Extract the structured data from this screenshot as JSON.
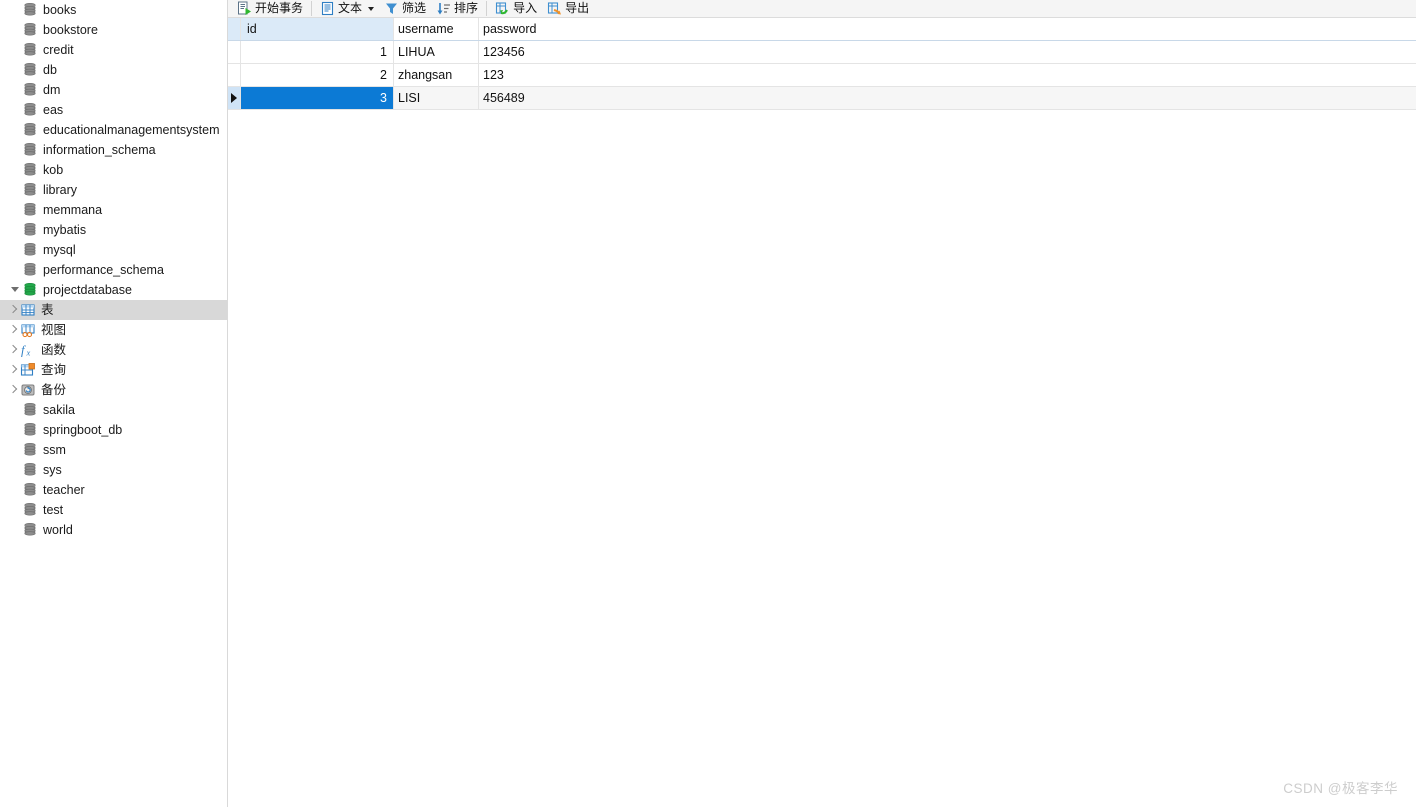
{
  "sidebar": {
    "items": [
      {
        "label": "books",
        "icon": "database-icon",
        "state": "collapsed",
        "connected": false,
        "level": "db"
      },
      {
        "label": "bookstore",
        "icon": "database-icon",
        "state": "collapsed",
        "connected": false,
        "level": "db"
      },
      {
        "label": "credit",
        "icon": "database-icon",
        "state": "collapsed",
        "connected": false,
        "level": "db"
      },
      {
        "label": "db",
        "icon": "database-icon",
        "state": "collapsed",
        "connected": false,
        "level": "db"
      },
      {
        "label": "dm",
        "icon": "database-icon",
        "state": "collapsed",
        "connected": false,
        "level": "db"
      },
      {
        "label": "eas",
        "icon": "database-icon",
        "state": "collapsed",
        "connected": false,
        "level": "db"
      },
      {
        "label": "educationalmanagementsystem",
        "icon": "database-icon",
        "state": "collapsed",
        "connected": false,
        "level": "db"
      },
      {
        "label": "information_schema",
        "icon": "database-icon",
        "state": "collapsed",
        "connected": false,
        "level": "db"
      },
      {
        "label": "kob",
        "icon": "database-icon",
        "state": "collapsed",
        "connected": false,
        "level": "db"
      },
      {
        "label": "library",
        "icon": "database-icon",
        "state": "collapsed",
        "connected": false,
        "level": "db"
      },
      {
        "label": "memmana",
        "icon": "database-icon",
        "state": "collapsed",
        "connected": false,
        "level": "db"
      },
      {
        "label": "mybatis",
        "icon": "database-icon",
        "state": "collapsed",
        "connected": false,
        "level": "db"
      },
      {
        "label": "mysql",
        "icon": "database-icon",
        "state": "collapsed",
        "connected": false,
        "level": "db"
      },
      {
        "label": "performance_schema",
        "icon": "database-icon",
        "state": "collapsed",
        "connected": false,
        "level": "db"
      },
      {
        "label": "projectdatabase",
        "icon": "database-icon",
        "state": "expanded",
        "connected": true,
        "level": "db"
      },
      {
        "label": "表",
        "icon": "table-icon",
        "state": "collapsed",
        "level": "child",
        "selected": true
      },
      {
        "label": "视图",
        "icon": "view-icon",
        "state": "collapsed",
        "level": "child"
      },
      {
        "label": "函数",
        "icon": "function-icon",
        "state": "collapsed",
        "level": "child"
      },
      {
        "label": "查询",
        "icon": "query-icon",
        "state": "collapsed",
        "level": "child"
      },
      {
        "label": "备份",
        "icon": "backup-icon",
        "state": "collapsed",
        "level": "child"
      },
      {
        "label": "sakila",
        "icon": "database-icon",
        "state": "collapsed",
        "connected": false,
        "level": "db"
      },
      {
        "label": "springboot_db",
        "icon": "database-icon",
        "state": "collapsed",
        "connected": false,
        "level": "db"
      },
      {
        "label": "ssm",
        "icon": "database-icon",
        "state": "collapsed",
        "connected": false,
        "level": "db"
      },
      {
        "label": "sys",
        "icon": "database-icon",
        "state": "collapsed",
        "connected": false,
        "level": "db"
      },
      {
        "label": "teacher",
        "icon": "database-icon",
        "state": "collapsed",
        "connected": false,
        "level": "db"
      },
      {
        "label": "test",
        "icon": "database-icon",
        "state": "collapsed",
        "connected": false,
        "level": "db"
      },
      {
        "label": "world",
        "icon": "database-icon",
        "state": "collapsed",
        "connected": false,
        "level": "db"
      }
    ]
  },
  "toolbar": {
    "begin_transaction_label": "开始事务",
    "text_label": "文本",
    "filter_label": "筛选",
    "sort_label": "排序",
    "import_label": "导入",
    "export_label": "导出"
  },
  "grid": {
    "columns": [
      "id",
      "username",
      "password"
    ],
    "rows": [
      {
        "id": "1",
        "username": "LIHUA",
        "password": "123456"
      },
      {
        "id": "2",
        "username": "zhangsan",
        "password": "123"
      },
      {
        "id": "3",
        "username": "LISI",
        "password": "456489"
      }
    ],
    "selected_row_index": 2,
    "selected_column": "id"
  },
  "watermark": {
    "text": "CSDN @极客李华"
  },
  "colors": {
    "selection_blue": "#0c7ad5",
    "header_selected": "#dbeaf8",
    "tree_selected": "#d8d8d8",
    "connected_db": "#22a84a",
    "toolbar_bg": "#f5f5f5"
  }
}
